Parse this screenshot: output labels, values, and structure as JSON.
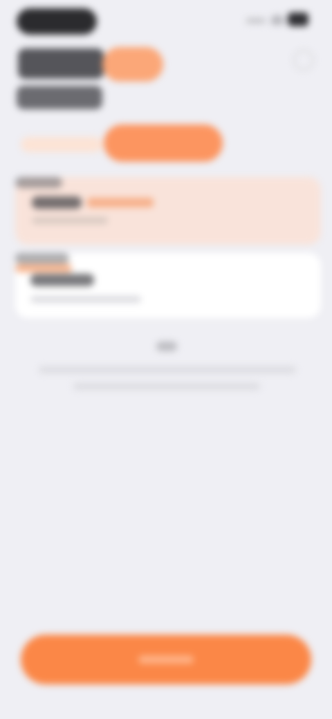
{
  "status_bar": {
    "icons": [
      "signal-icon",
      "wifi-icon",
      "battery-icon"
    ]
  },
  "colors": {
    "accent": "#fb8747",
    "accent_light": "#fc9560",
    "selected_card_bg": "#f9e3da",
    "background": "#efeff4"
  },
  "header": {
    "info_icon": "info-icon"
  }
}
